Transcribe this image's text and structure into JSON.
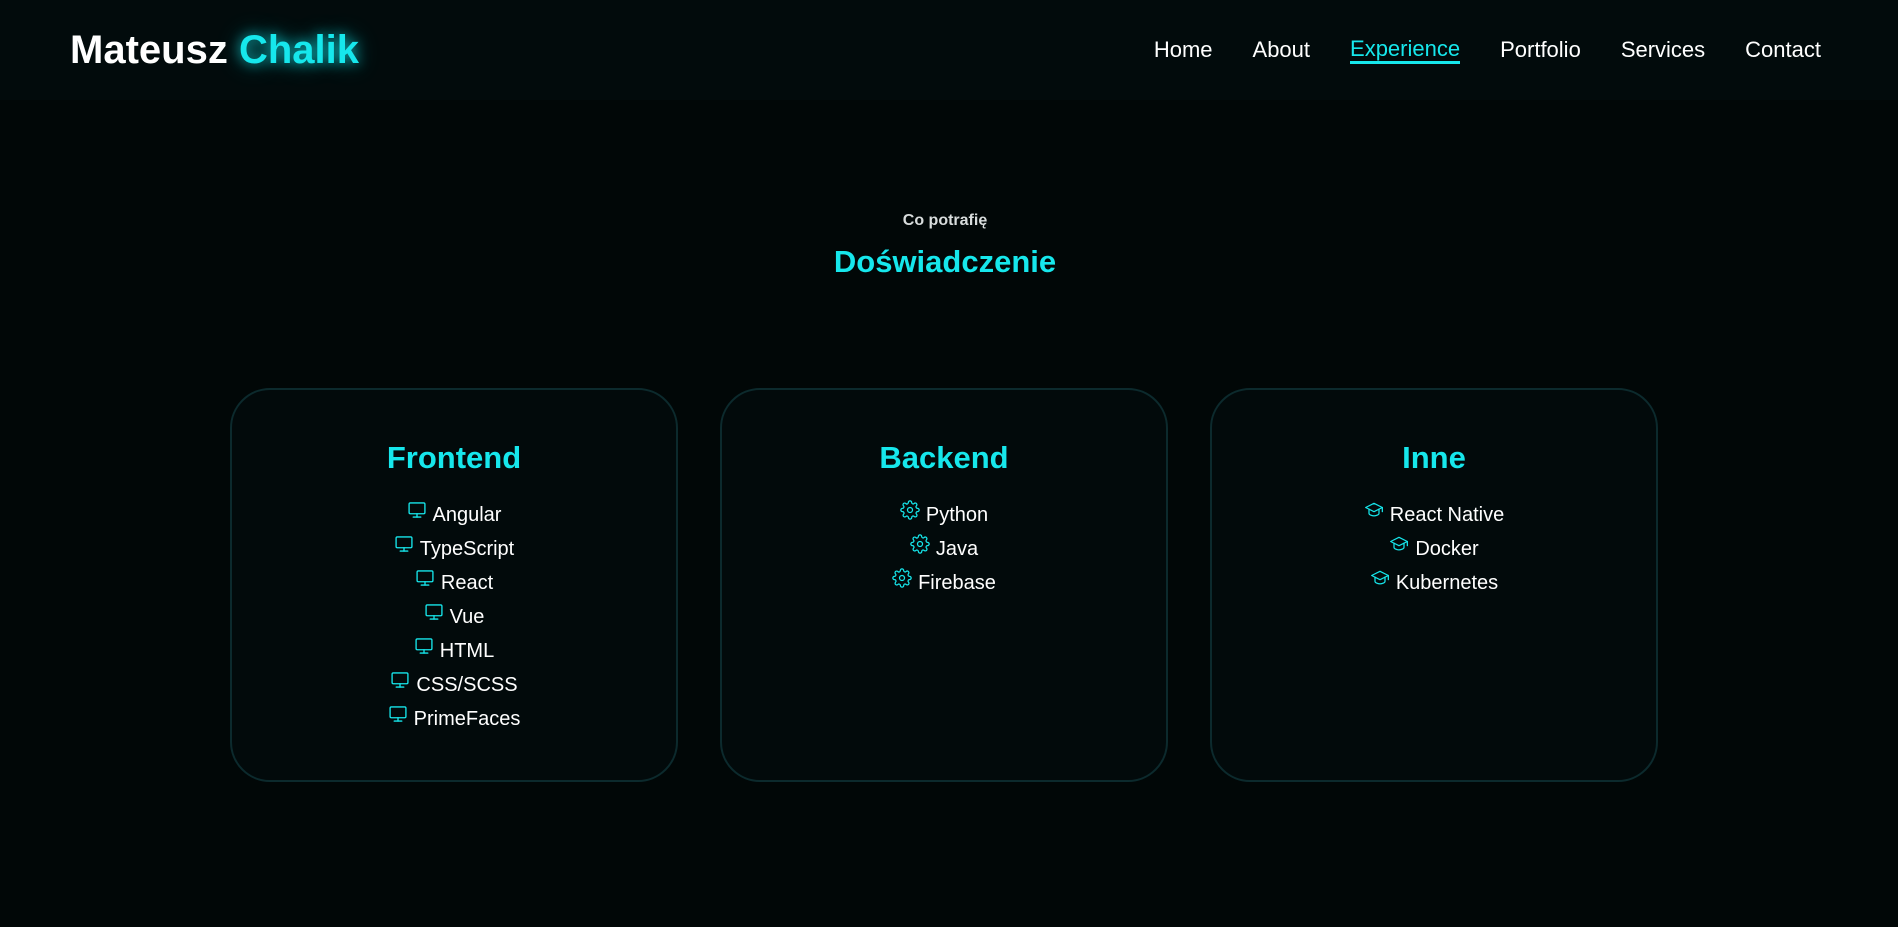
{
  "header": {
    "logo_first": "Mateusz",
    "logo_last": "Chalik",
    "nav": [
      {
        "label": "Home",
        "active": false
      },
      {
        "label": "About",
        "active": false
      },
      {
        "label": "Experience",
        "active": true
      },
      {
        "label": "Portfolio",
        "active": false
      },
      {
        "label": "Services",
        "active": false
      },
      {
        "label": "Contact",
        "active": false
      }
    ]
  },
  "section": {
    "subtitle": "Co potrafię",
    "title": "Doświadczenie"
  },
  "cards": [
    {
      "title": "Frontend",
      "icon": "monitor-icon",
      "items": [
        "Angular",
        "TypeScript",
        "React",
        "Vue",
        "HTML",
        "CSS/SCSS",
        "PrimeFaces"
      ]
    },
    {
      "title": "Backend",
      "icon": "gear-icon",
      "items": [
        "Python",
        "Java",
        "Firebase"
      ]
    },
    {
      "title": "Inne",
      "icon": "graduation-cap-icon",
      "items": [
        "React Native",
        "Docker",
        "Kubernetes"
      ]
    }
  ],
  "colors": {
    "accent": "#16e7ec",
    "background": "#010707",
    "card_border": "#0c2a2d",
    "text": "#ffffff"
  }
}
